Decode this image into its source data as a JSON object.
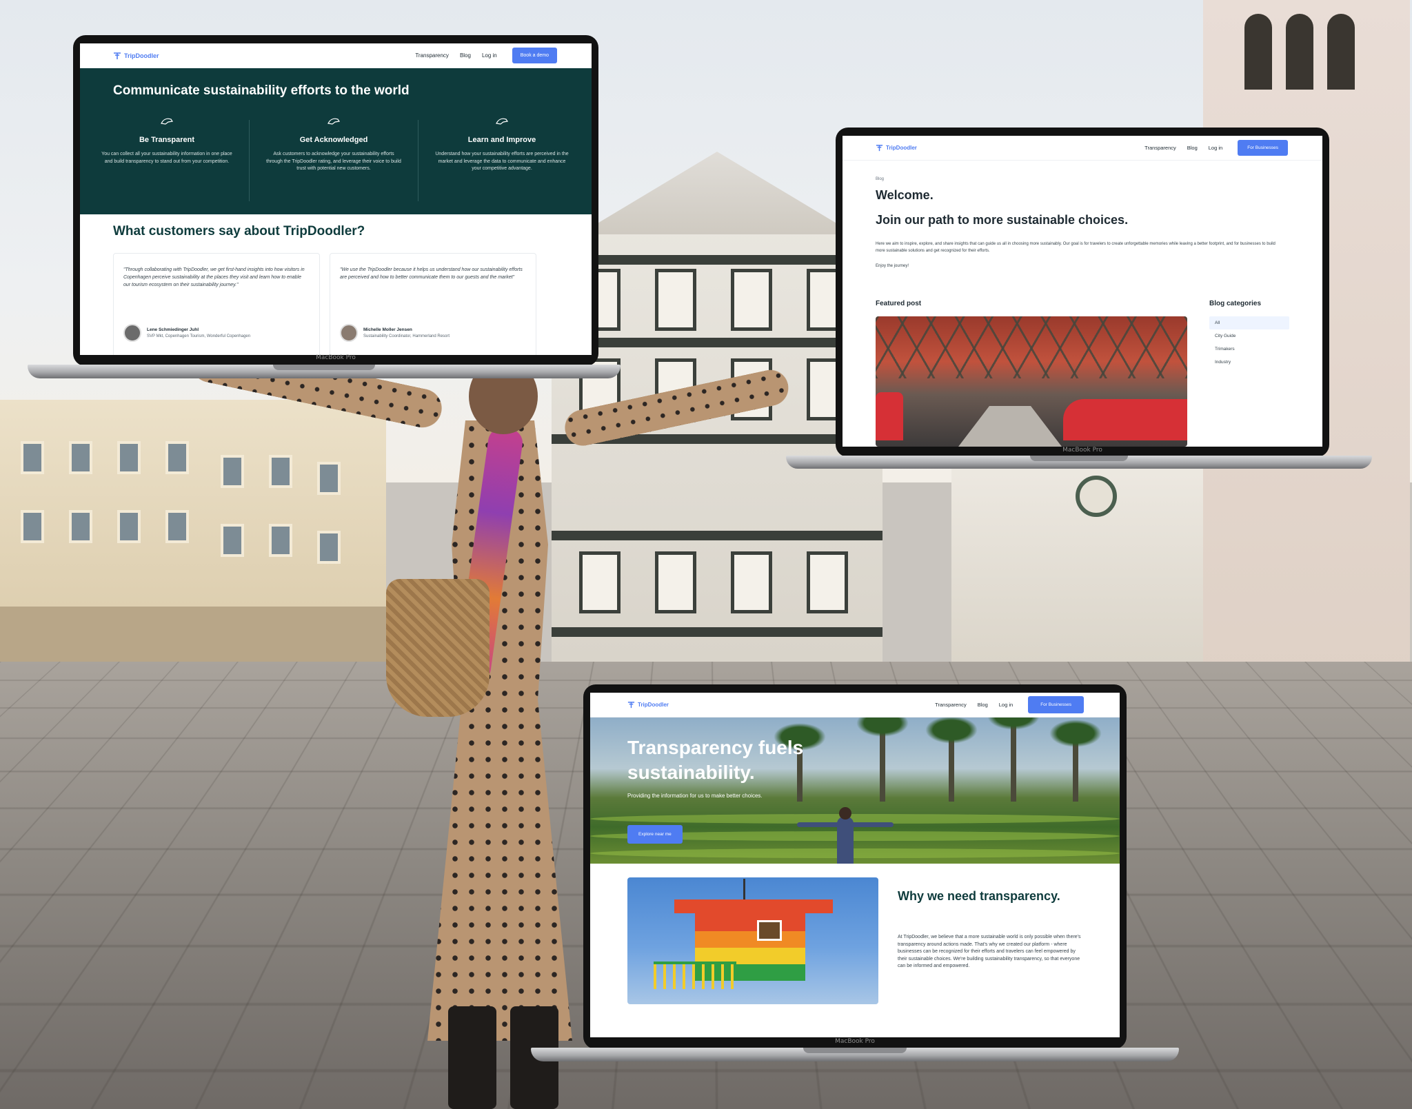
{
  "brand": {
    "name": "TripDoodler",
    "accent": "#4f7cf2",
    "dark_teal": "#0e3b3c"
  },
  "device_label": "MacBook Pro",
  "laptop1": {
    "nav": {
      "links": [
        "Transparency",
        "Blog",
        "Log in"
      ],
      "cta": "Book a demo"
    },
    "hero": {
      "title": "Communicate sustainability efforts to the world",
      "features": [
        {
          "icon": "pointing-hand-icon",
          "title": "Be Transparent",
          "text": "You can collect all your sustainability information in one place and build transparency to stand out from your competition."
        },
        {
          "icon": "pointing-hand-icon",
          "title": "Get Acknowledged",
          "text": "Ask customers to acknowledge your sustainability efforts through the TripDoodler rating, and leverage their voice to build trust with potential new customers."
        },
        {
          "icon": "pointing-hand-icon",
          "title": "Learn and Improve",
          "text": "Understand how your sustainability efforts are perceived in the market and leverage the data to communicate and enhance your competitive advantage."
        }
      ]
    },
    "testimonials": {
      "title": "What customers say about TripDoodler?",
      "items": [
        {
          "quote": "\"Through collaborating with TripDoodler, we get first-hand insights into how visitors in Copenhagen perceive sustainability at the places they visit and learn how to enable our tourism ecosystem on their sustainability journey.\"",
          "name": "Lene Schmiedinger Juhl",
          "role": "SVP Mkt, Copenhagen Tourism, Wonderful Copenhagen"
        },
        {
          "quote": "\"We use the TripDoodler because it helps us understand how our sustainability efforts are perceived and how to better communicate them to our guests and the market\"",
          "name": "Michelle Moller Jensen",
          "role": "Sustainability Coordinator, Hammerland Resort"
        }
      ]
    }
  },
  "laptop2": {
    "nav": {
      "links": [
        "Transparency",
        "Blog",
        "Log in"
      ],
      "cta": "For Businesses"
    },
    "breadcrumb": "Blog",
    "heading1": "Welcome.",
    "heading2": "Join our path to more sustainable choices.",
    "intro": "Here we aim to inspire, explore, and share insights that can guide us all in choosing more sustainably. Our goal is for travelers to create unforgettable memories while leaving a better footprint, and for businesses to build more sustainable solutions and get recognized for their efforts.",
    "enjoy": "Enjoy the journey!",
    "featured_title": "Featured post",
    "categories_title": "Blog categories",
    "categories": [
      "All",
      "City Guide",
      "Trimakers",
      "Industry"
    ],
    "active_category": "All"
  },
  "laptop3": {
    "nav": {
      "links": [
        "Transparency",
        "Blog",
        "Log in"
      ],
      "cta": "For Businesses"
    },
    "hero": {
      "title": "Transparency fuels sustainability.",
      "subtitle": "Providing the information for us to make better choices.",
      "cta": "Explore near me"
    },
    "why_title": "Why we need transparency.",
    "why_text": "At TripDoodler, we believe that a more sustainable world is only possible when there's transparency around actions made. That's why we created our platform - where businesses can be recognized for their efforts and travelers can feel empowered by their sustainable choices. We're building sustainability transparency, so that everyone can be informed and empowered."
  }
}
